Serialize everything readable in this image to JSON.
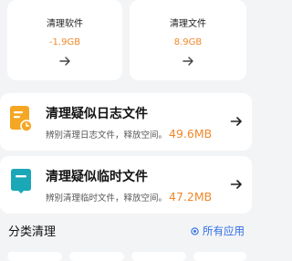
{
  "top_cards": [
    {
      "title": "清理软件",
      "value": "-1.9GB",
      "icon": "arrow-right-icon"
    },
    {
      "title": "清理文件",
      "value": "8.9GB",
      "icon": "arrow-right-icon"
    }
  ],
  "rows": [
    {
      "title": "清理疑似日志文件",
      "desc": "辨别清理日志文件，释放空间。",
      "size": "49.6MB",
      "icon": "log-file-clock-icon",
      "icon_color": "#f5a623"
    },
    {
      "title": "清理疑似临时文件",
      "desc": "辨别清理临时文件，释放空间。",
      "size": "47.2MB",
      "icon": "temp-file-icon",
      "icon_color": "#1aa7b8"
    }
  ],
  "section": {
    "title": "分类清理",
    "link_label": "所有应用",
    "link_icon": "target-icon"
  },
  "colors": {
    "accent_orange": "#f0882a",
    "link_blue": "#2f6fe6",
    "background": "#f3f4f6"
  }
}
